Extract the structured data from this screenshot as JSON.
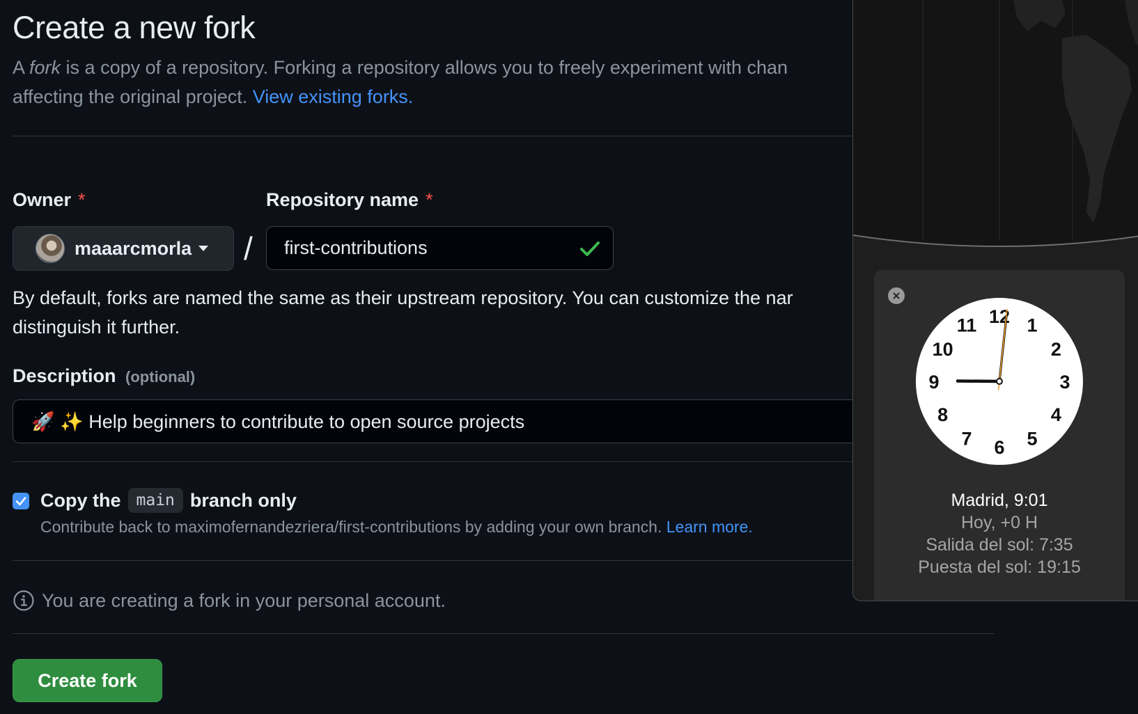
{
  "page": {
    "title": "Create a new fork",
    "intro_prefix": "A ",
    "intro_em": "fork",
    "intro_rest": " is a copy of a repository. Forking a repository allows you to freely experiment with chan",
    "intro_line2": "affecting the original project. ",
    "intro_link": "View existing forks."
  },
  "owner": {
    "label": "Owner",
    "required": "*",
    "name": "maaarcmorla"
  },
  "separator": "/",
  "repo": {
    "label": "Repository name",
    "required": "*",
    "value": "first-contributions",
    "status_icon": "check-icon"
  },
  "helper": {
    "line1": "By default, forks are named the same as their upstream repository. You can customize the nar",
    "line2": "distinguish it further."
  },
  "description": {
    "label": "Description",
    "optional": "(optional)",
    "value": "🚀 ✨ Help beginners to contribute to open source projects"
  },
  "copy_branch": {
    "checked": true,
    "label_prefix": "Copy the",
    "branch": "main",
    "label_suffix": "branch only",
    "note": "Contribute back to maximofernandezriera/first-contributions by adding your own branch. ",
    "note_link": "Learn more."
  },
  "info": {
    "icon": "info-icon",
    "text": "You are creating a fork in your personal account."
  },
  "actions": {
    "create_label": "Create fork"
  },
  "clock_widget": {
    "numerals": [
      "12",
      "1",
      "2",
      "3",
      "4",
      "5",
      "6",
      "7",
      "8",
      "9",
      "10",
      "11"
    ],
    "time": {
      "hour": 9,
      "minute": 1,
      "second": 1
    },
    "city_line": "Madrid, 9:01",
    "offset_line": "Hoy, +0 H",
    "sunrise_line": "Salida del sol: 7:35",
    "sunset_line": "Puesta del sol: 19:15"
  },
  "colors": {
    "accent": "#4493f8",
    "success": "#2f8d3f",
    "danger": "#f85149",
    "second_hand": "#f0a030"
  }
}
